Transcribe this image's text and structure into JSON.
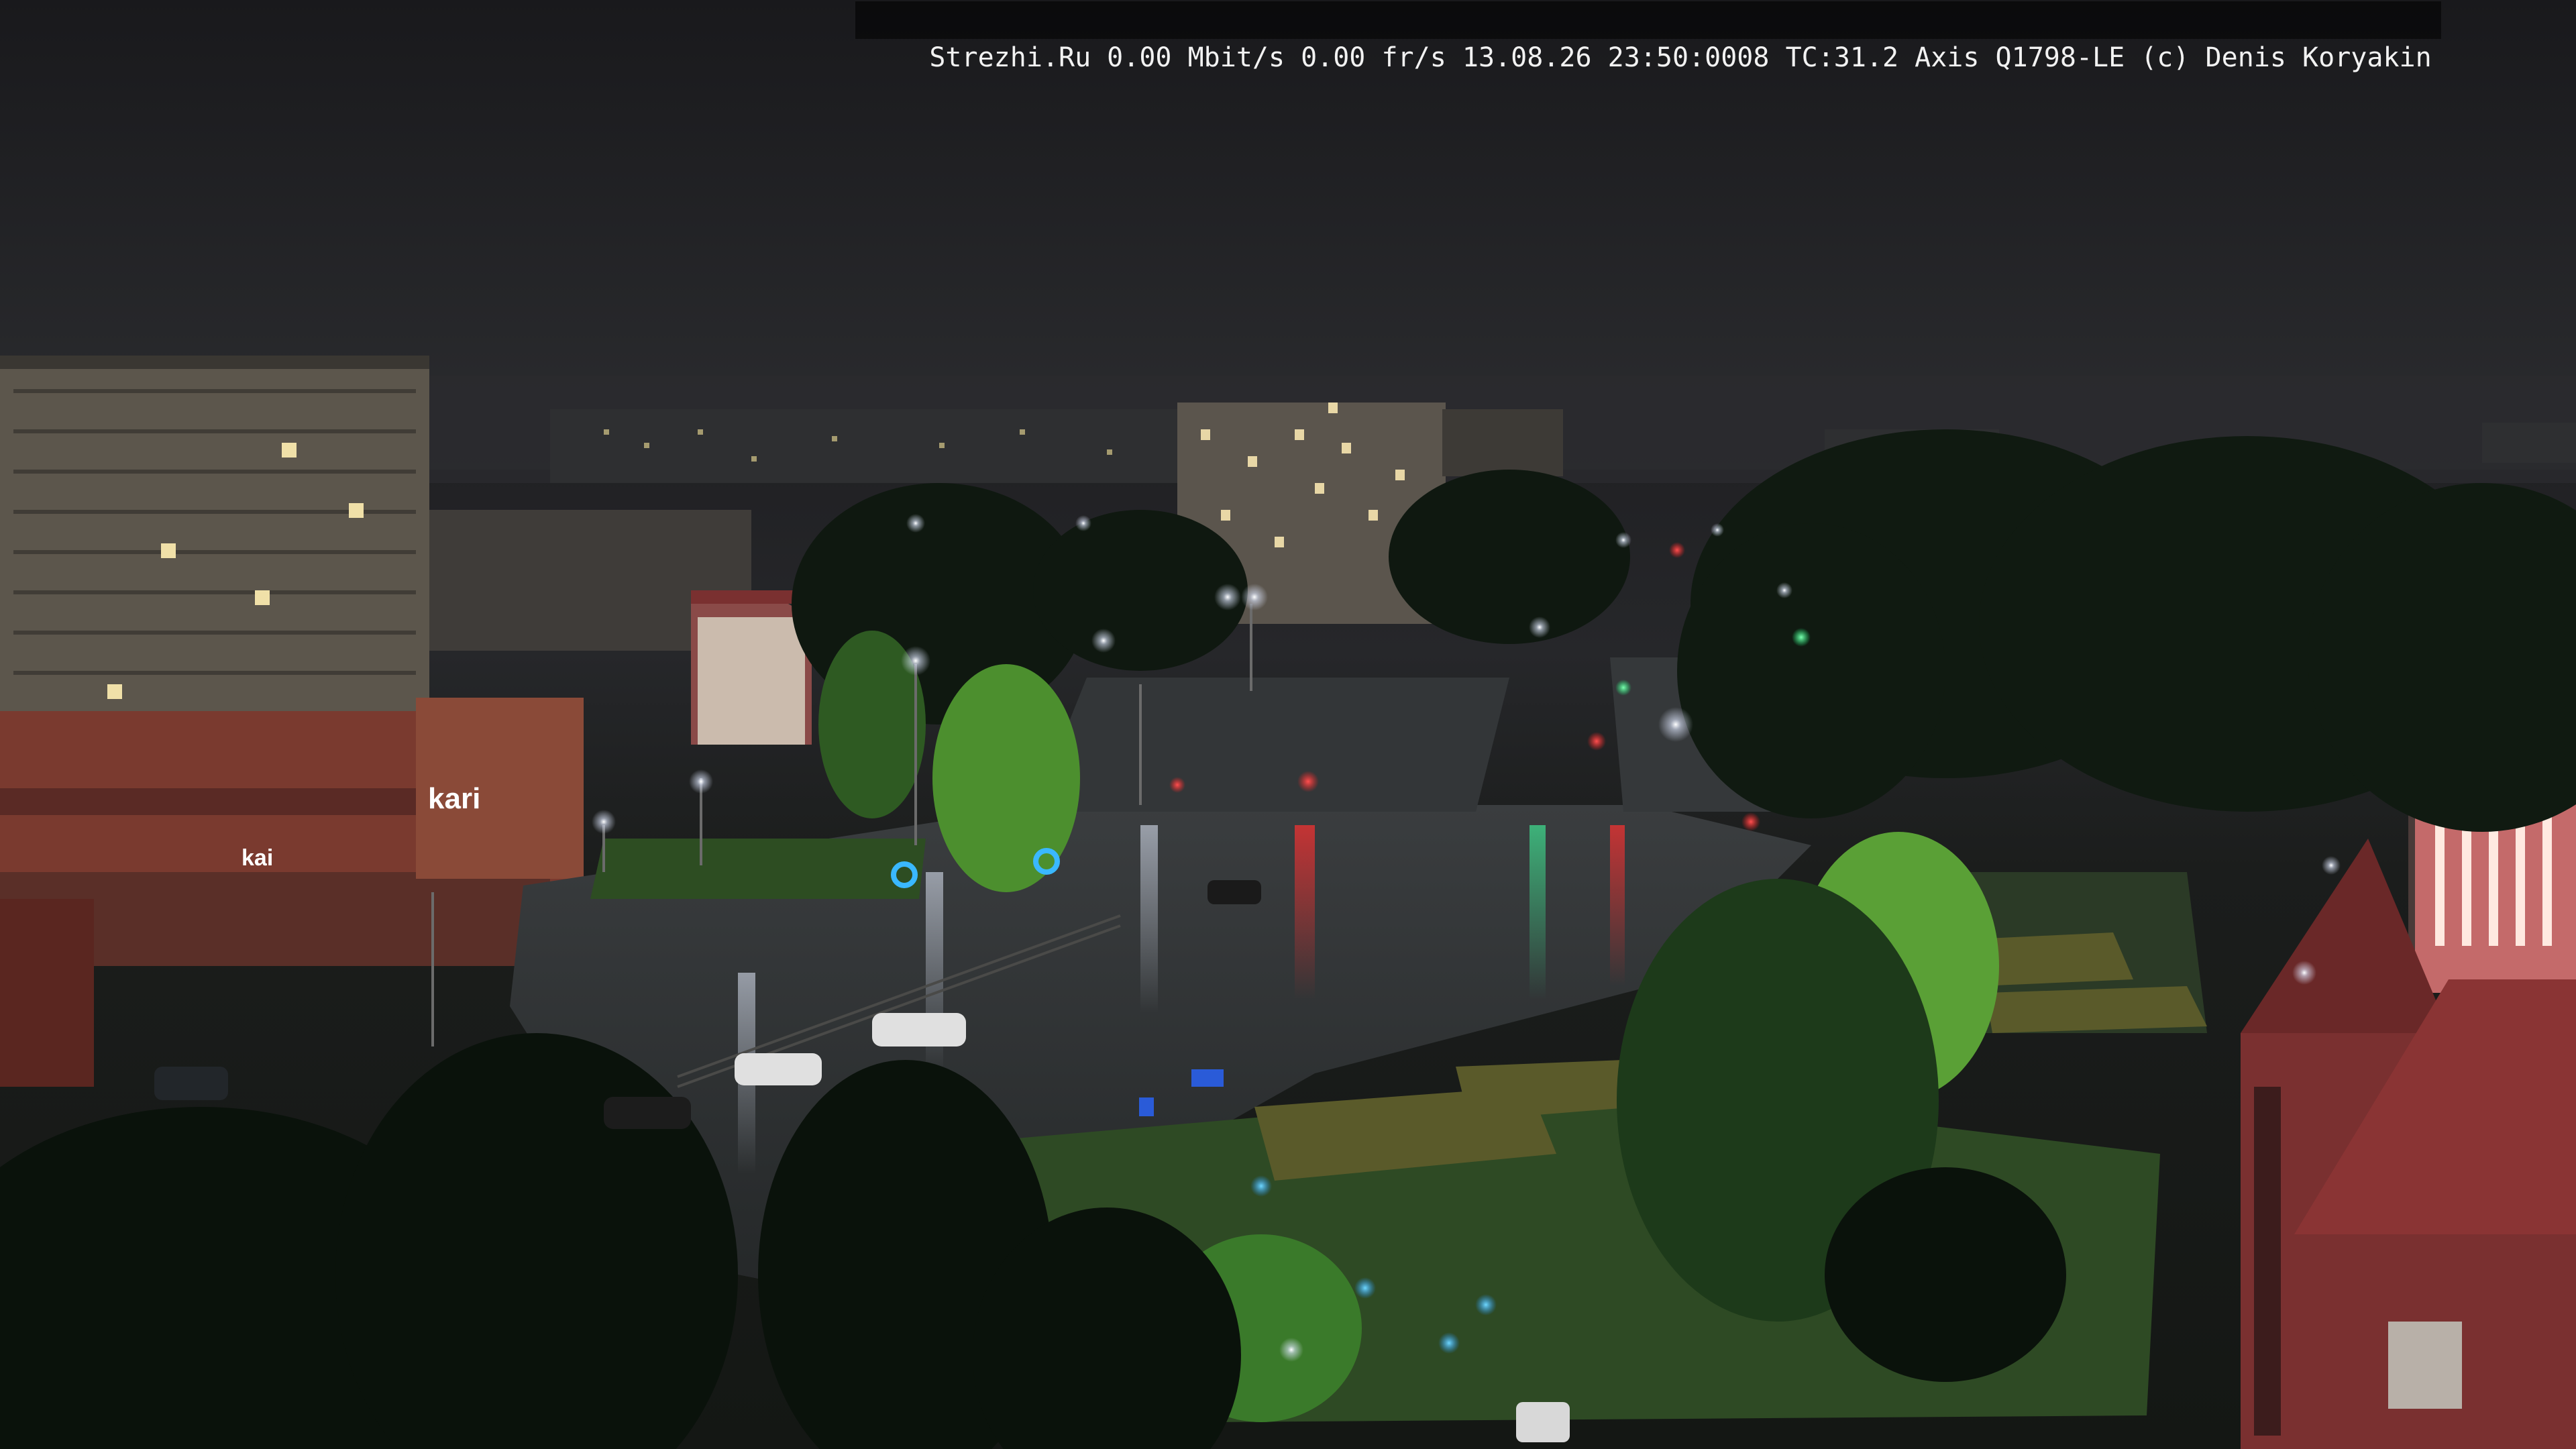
{
  "overlay": {
    "site": "Strezhi.Ru",
    "bitrate": "0.00 Mbit/s",
    "framerate": "0.00 fr/s",
    "datetime": "13.08.26 23:50:0008",
    "temperature": "TC:31.2",
    "camera_model": "Axis Q1798-LE",
    "copyright": "(c) Denis Koryakin"
  },
  "signage": {
    "store_sign": "kari",
    "store_sign_small": "kai"
  },
  "colors": {
    "sky": "#1e1e21",
    "fog": "#2b2c2f",
    "asphalt_wet": "#2a2d2e",
    "tree_dark": "#0f1a10",
    "tree_lit": "#6fb23a",
    "street_light": "#e8f0ff",
    "traffic_red": "#ff2a2a",
    "traffic_green": "#33ff88",
    "building_red": "#7a2a2a",
    "building_beige": "#5a5248"
  }
}
